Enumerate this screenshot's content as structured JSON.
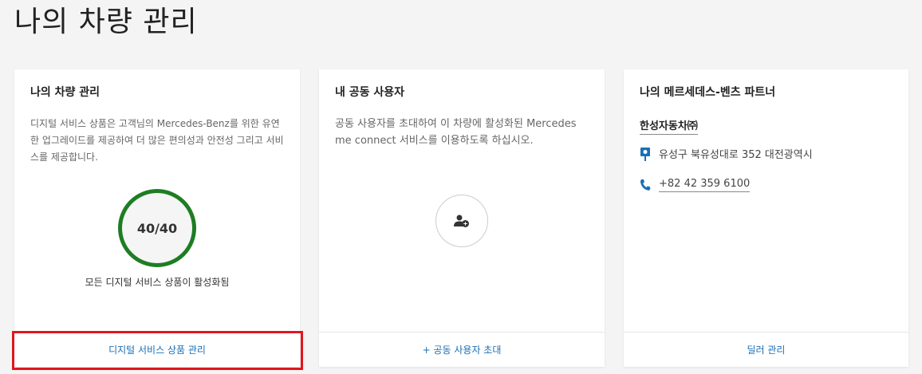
{
  "page": {
    "title": "나의 차량 관리"
  },
  "cards": {
    "vehicle": {
      "title": "나의 차량 관리",
      "description": "디지털 서비스 상품은 고객님의 Mercedes-Benz를 위한 유연한 업그레이드를 제공하여 더 많은 편의성과 안전성 그리고 서비스를 제공합니다.",
      "progress_value": "40/40",
      "progress_fraction": 1.0,
      "caption": "모든 디지털 서비스 상품이 활성화됨",
      "footer_link": "디지털 서비스 상품 관리"
    },
    "co_users": {
      "title": "내 공동 사용자",
      "description": "공동 사용자를 초대하여 이 차량에 활성화된 Mercedes me connect 서비스를 이용하도록 하십시오.",
      "add_icon": "add-user-icon",
      "footer_link": "+ 공동 사용자 초대"
    },
    "partner": {
      "title": "나의 메르세데스-벤츠 파트너",
      "name": "한성자동차㈜",
      "address": "유성구 북유성대로 352 대전광역시",
      "phone": "+82 42 359 6100",
      "footer_link": "딜러 관리"
    }
  },
  "colors": {
    "ring": "#1e7d23",
    "link": "#1a6fb5",
    "highlight": "#e0161e"
  }
}
